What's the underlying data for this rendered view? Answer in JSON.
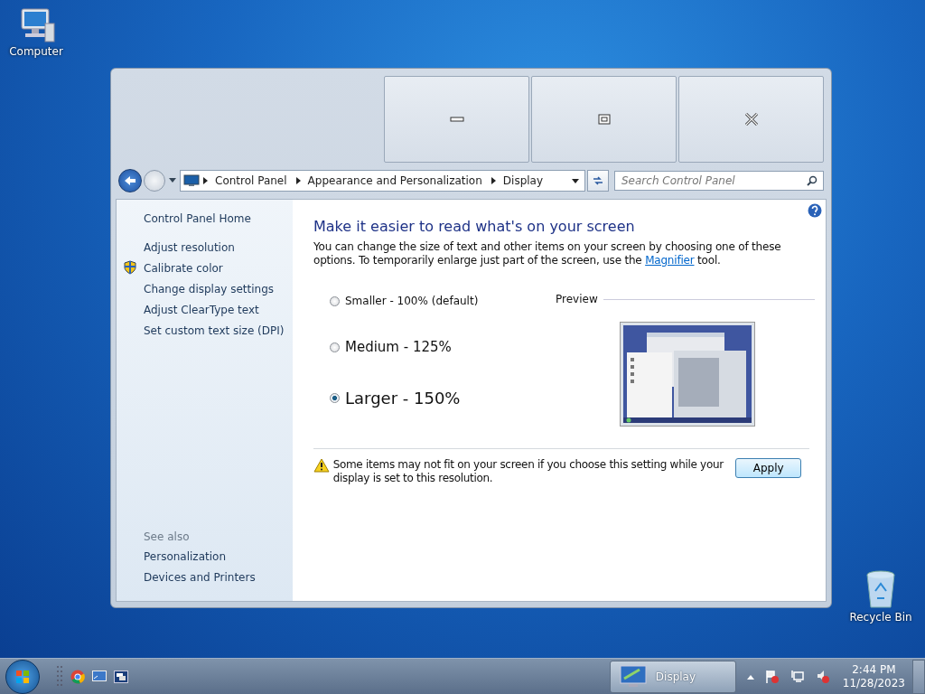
{
  "desktop_icons": [
    {
      "label": "Computer",
      "kind": "computer"
    },
    {
      "label": "Recycle Bin",
      "kind": "bin"
    }
  ],
  "address_bar": {
    "breadcrumbs": [
      "Control Panel",
      "Appearance and Personalization",
      "Display"
    ]
  },
  "search": {
    "placeholder": "Search Control Panel"
  },
  "sidebar": {
    "home": "Control Panel Home",
    "items": [
      {
        "label": "Adjust resolution",
        "shield": false
      },
      {
        "label": "Calibrate color",
        "shield": true
      },
      {
        "label": "Change display settings",
        "shield": false
      },
      {
        "label": "Adjust ClearType text",
        "shield": false
      },
      {
        "label": "Set custom text size (DPI)",
        "shield": false
      }
    ],
    "see_also_title": "See also",
    "see_also": [
      "Personalization",
      "Devices and Printers"
    ]
  },
  "content": {
    "title": "Make it easier to read what's on your screen",
    "intro_before": "You can change the size of text and other items on your screen by choosing one of these options. To temporarily enlarge just part of the screen, use the",
    "intro_link": "Magnifier",
    "intro_after": "tool.",
    "options": [
      {
        "label": "Smaller - 100% (default)",
        "kind": "small",
        "selected": false
      },
      {
        "label": "Medium - 125%",
        "kind": "medium",
        "selected": false
      },
      {
        "label": "Larger - 150%",
        "kind": "large",
        "selected": true
      }
    ],
    "preview_label": "Preview",
    "warning": "Some items may not fit on your screen if you choose this setting while your display is set to this resolution.",
    "apply": "Apply"
  },
  "taskbar": {
    "task": "Display",
    "time": "2:44 PM",
    "date": "11/28/2023"
  }
}
